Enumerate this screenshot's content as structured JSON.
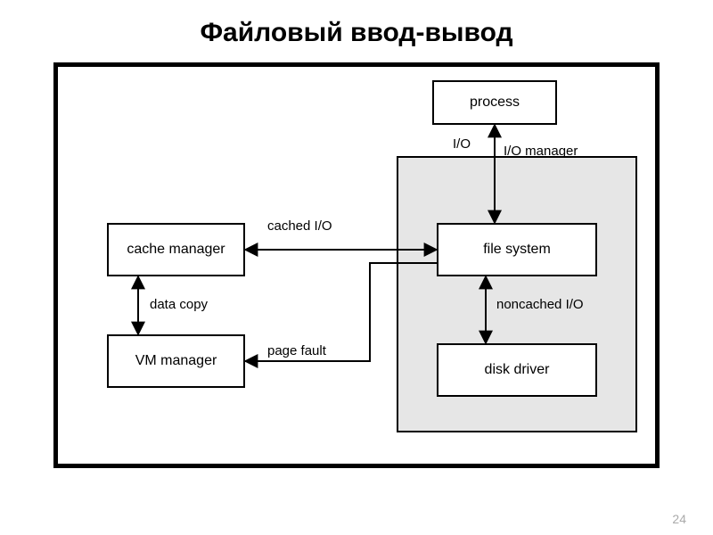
{
  "title": "Файловый ввод-вывод",
  "page_number": "24",
  "nodes": {
    "process": "process",
    "cache_manager": "cache manager",
    "vm_manager": "VM manager",
    "file_system": "file system",
    "disk_driver": "disk driver"
  },
  "labels": {
    "io": "I/O",
    "io_manager": "I/O manager",
    "cached_io": "cached I/O",
    "data_copy": "data copy",
    "noncached_io": "noncached I/O",
    "page_fault": "page fault"
  },
  "arrows": [
    {
      "from": "process",
      "to": "file_system",
      "doubled": true
    },
    {
      "from": "cache_manager",
      "to": "file_system",
      "doubled": true
    },
    {
      "from": "cache_manager",
      "to": "vm_manager",
      "doubled": true
    },
    {
      "from": "file_system",
      "to": "disk_driver",
      "doubled": true
    },
    {
      "from": "file_system",
      "to": "vm_manager",
      "doubled": false
    }
  ]
}
